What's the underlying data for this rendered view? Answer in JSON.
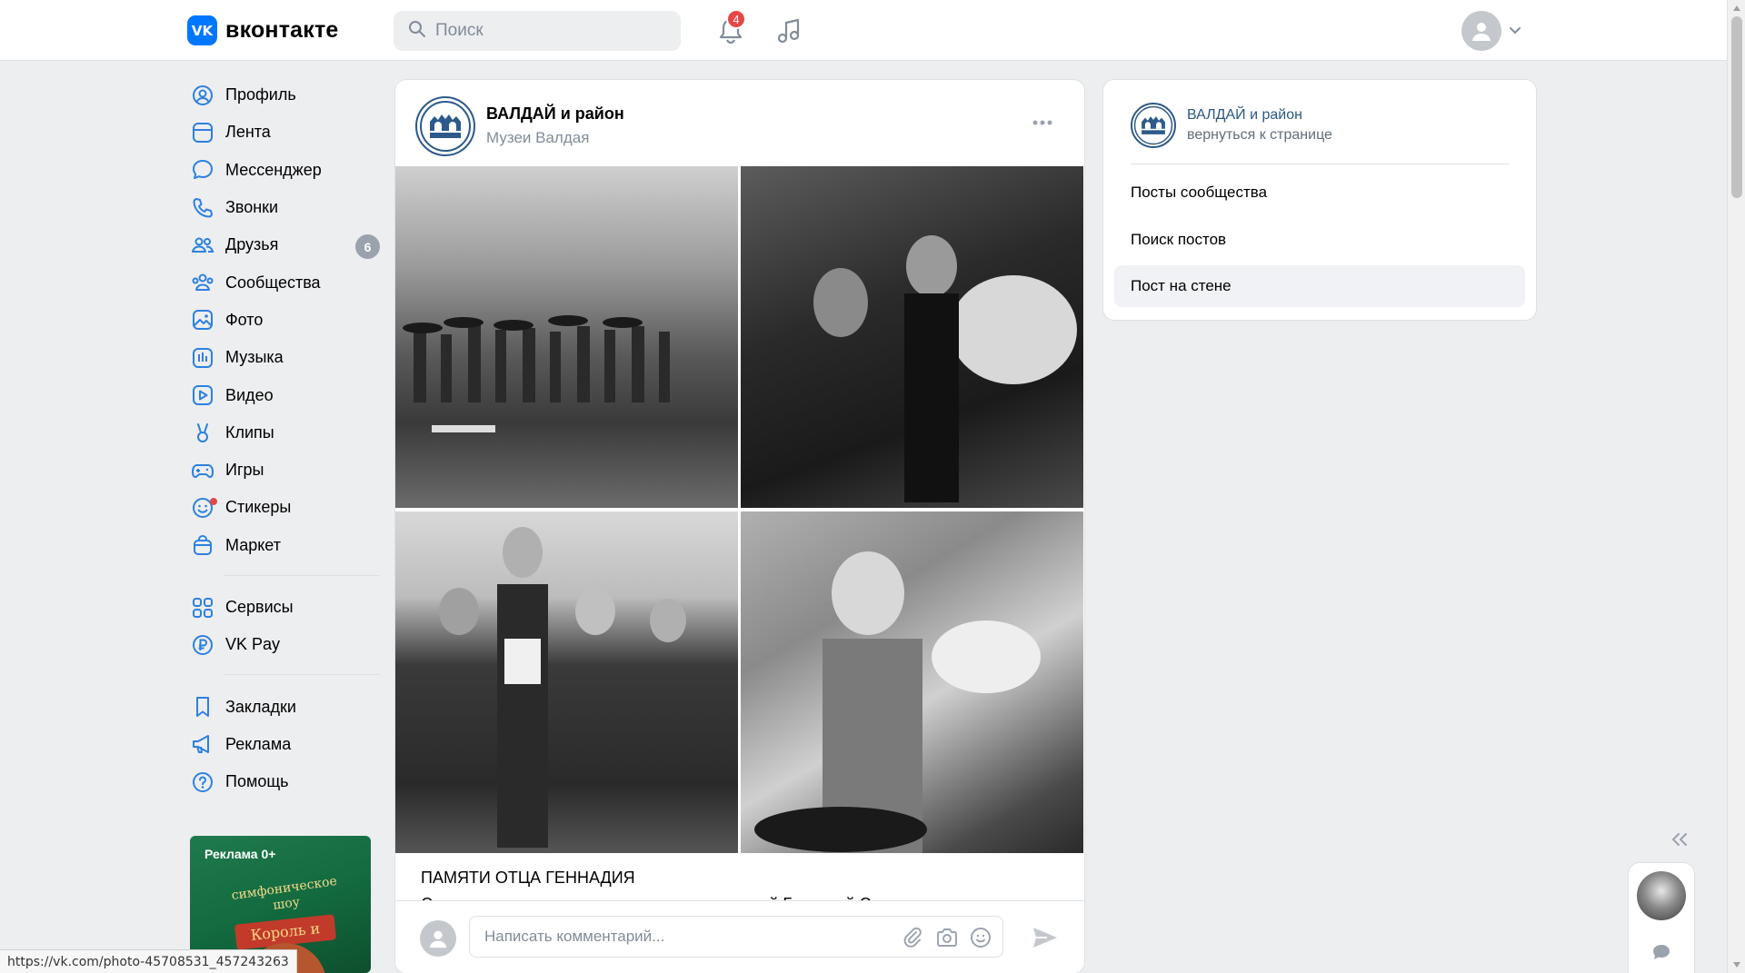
{
  "header": {
    "logo_text": "вконтакте",
    "logo_mark": "VK",
    "search_placeholder": "Поиск",
    "notifications_count": "4",
    "icons": [
      "search-icon",
      "bell-icon",
      "music-icon",
      "chevron-down-icon"
    ]
  },
  "sidebar": {
    "items": [
      {
        "label": "Профиль",
        "icon": "user-circle-icon"
      },
      {
        "label": "Лента",
        "icon": "feed-icon"
      },
      {
        "label": "Мессенджер",
        "icon": "message-icon"
      },
      {
        "label": "Звонки",
        "icon": "phone-icon"
      },
      {
        "label": "Друзья",
        "icon": "users-icon",
        "badge": "6"
      },
      {
        "label": "Сообщества",
        "icon": "community-icon"
      },
      {
        "label": "Фото",
        "icon": "photo-icon"
      },
      {
        "label": "Музыка",
        "icon": "music-icon"
      },
      {
        "label": "Видео",
        "icon": "video-icon"
      },
      {
        "label": "Клипы",
        "icon": "clips-icon"
      },
      {
        "label": "Игры",
        "icon": "gamepad-icon"
      },
      {
        "label": "Стикеры",
        "icon": "smile-icon"
      },
      {
        "label": "Маркет",
        "icon": "bag-icon"
      }
    ],
    "services": [
      {
        "label": "Сервисы",
        "icon": "grid-icon"
      },
      {
        "label": "VK Pay",
        "icon": "ruble-icon"
      }
    ],
    "more": [
      {
        "label": "Закладки",
        "icon": "bookmark-icon"
      },
      {
        "label": "Реклама",
        "icon": "megaphone-icon"
      },
      {
        "label": "Помощь",
        "icon": "help-icon"
      }
    ],
    "ad": {
      "label": "Реклама 0+",
      "title": "симфоническое шоу",
      "subtitle": "Король и Шут"
    }
  },
  "post": {
    "author": "ВАЛДАЙ и район",
    "subtitle": "Музеи Валдая",
    "title": "ПАМЯТИ ОТЦА ГЕННАДИЯ",
    "text": "Сегодня скоропостижно скончался протоиерей Геннадий Степанов",
    "comment_placeholder": "Написать комментарий..."
  },
  "right_panel": {
    "community_name": "ВАЛДАЙ и район",
    "back_link": "вернуться к странице",
    "items": [
      {
        "label": "Посты сообщества"
      },
      {
        "label": "Поиск постов"
      },
      {
        "label": "Пост на стене",
        "active": true
      }
    ]
  },
  "status_bar": {
    "url": "https://vk.com/photo-45708531_457243263"
  },
  "colors": {
    "accent": "#0077ff",
    "link": "#2a5885",
    "badge_red": "#e64646",
    "background": "#edeef0"
  }
}
